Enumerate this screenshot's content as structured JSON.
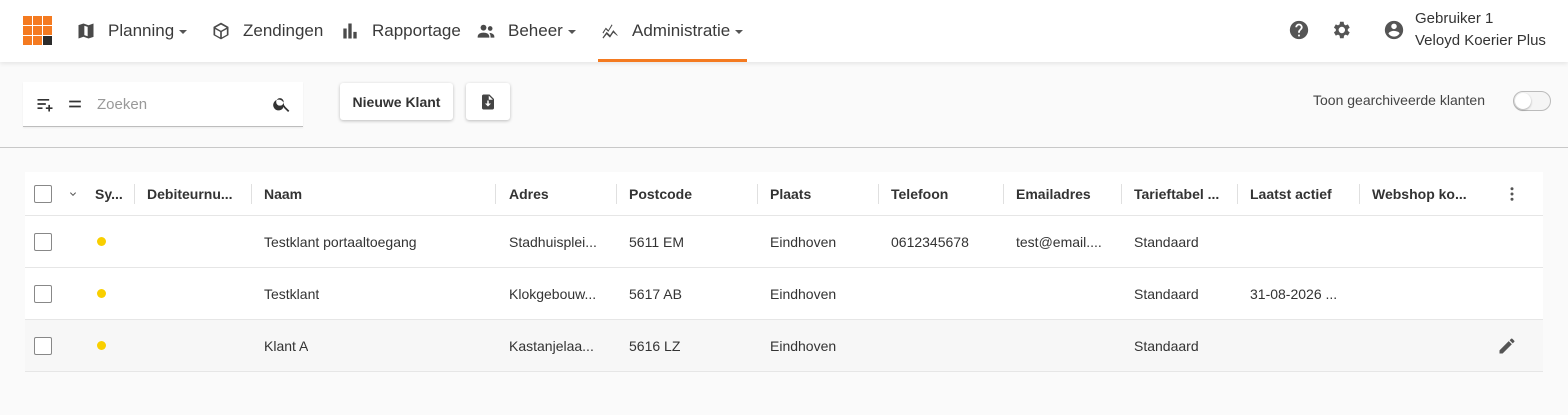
{
  "nav": {
    "items": [
      {
        "label": "Planning",
        "icon": "map-icon",
        "dropdown": true
      },
      {
        "label": "Zendingen",
        "icon": "package-icon",
        "dropdown": false
      },
      {
        "label": "Rapportage",
        "icon": "bar-chart-icon",
        "dropdown": false
      },
      {
        "label": "Beheer",
        "icon": "people-icon",
        "dropdown": true
      },
      {
        "label": "Administratie",
        "icon": "analytics-icon",
        "dropdown": true,
        "active": true
      }
    ],
    "user_name": "Gebruiker 1",
    "user_company": "Veloyd Koerier Plus"
  },
  "toolbar": {
    "search_placeholder": "Zoeken",
    "new_client_label": "Nieuwe Klant",
    "archive_toggle_label": "Toon gearchiveerde klanten",
    "archive_toggle_on": false
  },
  "table": {
    "columns": [
      "Sy...",
      "Debiteurnu...",
      "Naam",
      "Adres",
      "Postcode",
      "Plaats",
      "Telefoon",
      "Emailadres",
      "Tarieftabel ...",
      "Laatst actief",
      "Webshop ko..."
    ],
    "rows": [
      {
        "status": "yellow",
        "debiteurnummer": "",
        "naam": "Testklant portaaltoegang",
        "adres": "Stadhuisplei...",
        "postcode": "5611 EM",
        "plaats": "Eindhoven",
        "telefoon": "0612345678",
        "email": "test@email....",
        "tarieftabel": "Standaard",
        "laatst_actief": "",
        "webshop": ""
      },
      {
        "status": "yellow",
        "debiteurnummer": "",
        "naam": "Testklant",
        "adres": "Klokgebouw...",
        "postcode": "5617 AB",
        "plaats": "Eindhoven",
        "telefoon": "",
        "email": "",
        "tarieftabel": "Standaard",
        "laatst_actief": "31-08-2026 ...",
        "webshop": ""
      },
      {
        "status": "yellow",
        "debiteurnummer": "",
        "naam": "Klant A",
        "adres": "Kastanjelaa...",
        "postcode": "5616 LZ",
        "plaats": "Eindhoven",
        "telefoon": "",
        "email": "",
        "tarieftabel": "Standaard",
        "laatst_actief": "",
        "webshop": ""
      }
    ]
  },
  "colors": {
    "accent": "#f47a20",
    "status_yellow": "#f9cf00"
  }
}
